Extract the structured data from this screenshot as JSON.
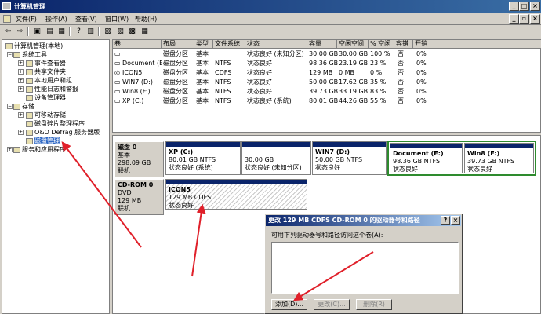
{
  "window": {
    "title": "计算机管理",
    "min": "_",
    "max": "□",
    "close": "×",
    "help": "?"
  },
  "menu": [
    "文件(F)",
    "操作(A)",
    "查看(V)",
    "窗口(W)",
    "帮助(H)"
  ],
  "tree": [
    {
      "label": "计算机管理(本地)",
      "icon": "computer-icon"
    },
    {
      "label": "系统工具",
      "icon": "tools-icon"
    },
    {
      "label": "事件查看器",
      "icon": "event-viewer-icon"
    },
    {
      "label": "共享文件夹",
      "icon": "shared-folder-icon"
    },
    {
      "label": "本地用户和组",
      "icon": "users-icon"
    },
    {
      "label": "性能日志和警报",
      "icon": "performance-icon"
    },
    {
      "label": "设备管理器",
      "icon": "device-manager-icon"
    },
    {
      "label": "存储",
      "icon": "storage-icon"
    },
    {
      "label": "可移动存储",
      "icon": "removable-storage-icon"
    },
    {
      "label": "磁盘碎片整理程序",
      "icon": "defrag-icon"
    },
    {
      "label": "O&O Defrag 服务器版",
      "icon": "defrag-server-icon"
    },
    {
      "label": "磁盘管理",
      "icon": "disk-management-icon"
    },
    {
      "label": "服务和应用程序",
      "icon": "services-icon"
    }
  ],
  "volume_table": {
    "headers": [
      "卷",
      "布局",
      "类型",
      "文件系统",
      "状态",
      "容量",
      "空闲空间",
      "% 空闲",
      "容错",
      "开销"
    ],
    "rows": [
      [
        "",
        "磁盘分区",
        "基本",
        "",
        "状态良好 (未知分区)",
        "30.00 GB",
        "30.00 GB",
        "100 %",
        "否",
        "0%"
      ],
      [
        "Document (E:)",
        "磁盘分区",
        "基本",
        "NTFS",
        "状态良好",
        "98.36 GB",
        "23.19 GB",
        "23 %",
        "否",
        "0%"
      ],
      [
        "ICON5",
        "磁盘分区",
        "基本",
        "CDFS",
        "状态良好",
        "129 MB",
        "0 MB",
        "0 %",
        "否",
        "0%"
      ],
      [
        "WIN7 (D:)",
        "磁盘分区",
        "基本",
        "NTFS",
        "状态良好",
        "50.00 GB",
        "17.62 GB",
        "35 %",
        "否",
        "0%"
      ],
      [
        "Win8 (F:)",
        "磁盘分区",
        "基本",
        "NTFS",
        "状态良好",
        "39.73 GB",
        "33.19 GB",
        "83 %",
        "否",
        "0%"
      ],
      [
        "XP (C:)",
        "磁盘分区",
        "基本",
        "NTFS",
        "状态良好 (系统)",
        "80.01 GB",
        "44.26 GB",
        "55 %",
        "否",
        "0%"
      ]
    ]
  },
  "disk0": {
    "name": "磁盘 0",
    "type": "基本",
    "size": "298.09 GB",
    "status": "联机",
    "partitions": [
      {
        "l1": "XP (C:)",
        "l2": "80.01 GB NTFS",
        "l3": "状态良好 (系统)"
      },
      {
        "l1": "",
        "l2": "30.00 GB",
        "l3": "状态良好 (未知分区)"
      },
      {
        "l1": "WIN7 (D:)",
        "l2": "50.00 GB NTFS",
        "l3": "状态良好"
      },
      {
        "l1": "Document (E:)",
        "l2": "98.36 GB NTFS",
        "l3": "状态良好"
      },
      {
        "l1": "Win8 (F:)",
        "l2": "39.73 GB NTFS",
        "l3": "状态良好"
      }
    ]
  },
  "cdrom0": {
    "name": "CD-ROM 0",
    "type": "DVD",
    "size": "129 MB",
    "status": "联机",
    "partition": {
      "l1": "ICON5",
      "l2": "129 MB CDFS",
      "l3": "状态良好"
    }
  },
  "dialog": {
    "title": "更改 129 MB CDFS CD-ROM 0 的驱动器号和路径",
    "prompt": "可用下列驱动器号和路径访问这个卷(A):",
    "add": "添加(D)...",
    "change": "更改(C)...",
    "remove": "删除(R)"
  },
  "colors": {
    "title": "#0a246a",
    "partition_bar": "#0a246a",
    "arrow": "#e0202a",
    "selection": "#316ac5",
    "extended": "#2e8b2e"
  }
}
